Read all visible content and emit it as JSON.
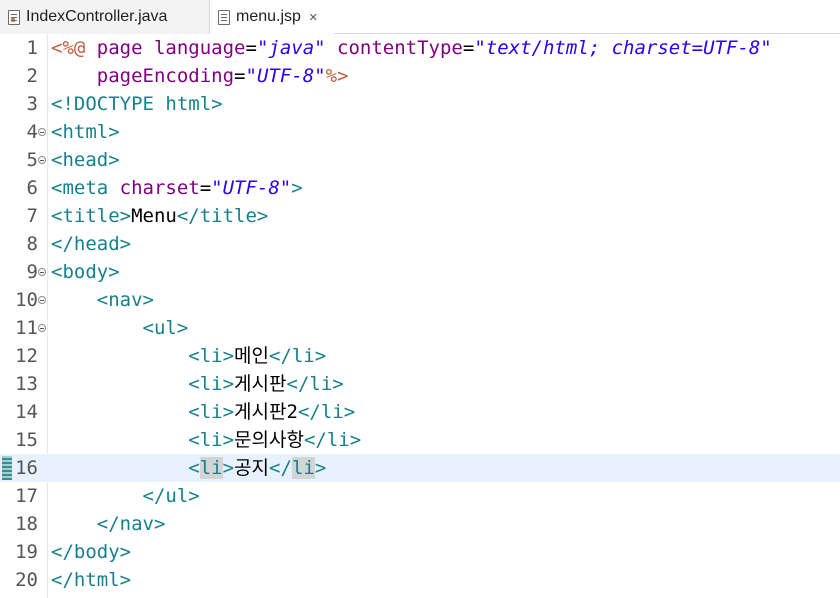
{
  "tabs": [
    {
      "label": "IndexController.java",
      "active": false,
      "icon": "java-file-icon"
    },
    {
      "label": "menu.jsp",
      "active": true,
      "icon": "jsp-file-icon",
      "close": "×"
    }
  ],
  "lines": [
    {
      "num": "1",
      "fold": false,
      "current": false,
      "segments": [
        {
          "t": "dir",
          "v": "<%@ "
        },
        {
          "t": "attr",
          "v": "page "
        },
        {
          "t": "attr",
          "v": "language"
        },
        {
          "t": "txt",
          "v": "="
        },
        {
          "t": "val",
          "v": "\"java\""
        },
        {
          "t": "txt",
          "v": " "
        },
        {
          "t": "attr",
          "v": "contentType"
        },
        {
          "t": "txt",
          "v": "="
        },
        {
          "t": "val",
          "v": "\"text/html; charset=UTF-8\""
        }
      ]
    },
    {
      "num": "2",
      "fold": false,
      "current": false,
      "segments": [
        {
          "t": "txt",
          "v": "    "
        },
        {
          "t": "attr",
          "v": "pageEncoding"
        },
        {
          "t": "txt",
          "v": "="
        },
        {
          "t": "val",
          "v": "\"UTF-8\""
        },
        {
          "t": "dir",
          "v": "%>"
        }
      ]
    },
    {
      "num": "3",
      "fold": false,
      "current": false,
      "segments": [
        {
          "t": "tag",
          "v": "<!DOCTYPE "
        },
        {
          "t": "kw",
          "v": "html"
        },
        {
          "t": "tag",
          "v": ">"
        }
      ]
    },
    {
      "num": "4",
      "fold": true,
      "current": false,
      "segments": [
        {
          "t": "tag",
          "v": "<html>"
        }
      ]
    },
    {
      "num": "5",
      "fold": true,
      "current": false,
      "segments": [
        {
          "t": "tag",
          "v": "<head>"
        }
      ]
    },
    {
      "num": "6",
      "fold": false,
      "current": false,
      "segments": [
        {
          "t": "tag",
          "v": "<meta "
        },
        {
          "t": "attr",
          "v": "charset"
        },
        {
          "t": "txt",
          "v": "="
        },
        {
          "t": "val",
          "v": "\"UTF-8\""
        },
        {
          "t": "tag",
          "v": ">"
        }
      ]
    },
    {
      "num": "7",
      "fold": false,
      "current": false,
      "segments": [
        {
          "t": "tag",
          "v": "<title>"
        },
        {
          "t": "txt",
          "v": "Menu"
        },
        {
          "t": "tag",
          "v": "</title>"
        }
      ]
    },
    {
      "num": "8",
      "fold": false,
      "current": false,
      "segments": [
        {
          "t": "tag",
          "v": "</head>"
        }
      ]
    },
    {
      "num": "9",
      "fold": true,
      "current": false,
      "segments": [
        {
          "t": "tag",
          "v": "<body>"
        }
      ]
    },
    {
      "num": "10",
      "fold": true,
      "current": false,
      "segments": [
        {
          "t": "txt",
          "v": "    "
        },
        {
          "t": "tag",
          "v": "<nav>"
        }
      ]
    },
    {
      "num": "11",
      "fold": true,
      "current": false,
      "segments": [
        {
          "t": "txt",
          "v": "        "
        },
        {
          "t": "tag",
          "v": "<ul>"
        }
      ]
    },
    {
      "num": "12",
      "fold": false,
      "current": false,
      "segments": [
        {
          "t": "txt",
          "v": "            "
        },
        {
          "t": "tag",
          "v": "<li>"
        },
        {
          "t": "txt",
          "v": "메인"
        },
        {
          "t": "tag",
          "v": "</li>"
        }
      ]
    },
    {
      "num": "13",
      "fold": false,
      "current": false,
      "segments": [
        {
          "t": "txt",
          "v": "            "
        },
        {
          "t": "tag",
          "v": "<li>"
        },
        {
          "t": "txt",
          "v": "게시판"
        },
        {
          "t": "tag",
          "v": "</li>"
        }
      ]
    },
    {
      "num": "14",
      "fold": false,
      "current": false,
      "segments": [
        {
          "t": "txt",
          "v": "            "
        },
        {
          "t": "tag",
          "v": "<li>"
        },
        {
          "t": "txt",
          "v": "게시판2"
        },
        {
          "t": "tag",
          "v": "</li>"
        }
      ]
    },
    {
      "num": "15",
      "fold": false,
      "current": false,
      "segments": [
        {
          "t": "txt",
          "v": "            "
        },
        {
          "t": "tag",
          "v": "<li>"
        },
        {
          "t": "txt",
          "v": "문의사항"
        },
        {
          "t": "tag",
          "v": "</li>"
        }
      ]
    },
    {
      "num": "16",
      "fold": false,
      "current": true,
      "segments": [
        {
          "t": "txt",
          "v": "            "
        },
        {
          "t": "tag",
          "v": "<"
        },
        {
          "t": "tag hl",
          "v": "li"
        },
        {
          "t": "tag",
          "v": ">"
        },
        {
          "t": "txt",
          "v": "공지"
        },
        {
          "t": "tag",
          "v": "</"
        },
        {
          "t": "tag hl",
          "v": "li"
        },
        {
          "t": "tag",
          "v": ">"
        }
      ]
    },
    {
      "num": "17",
      "fold": false,
      "current": false,
      "segments": [
        {
          "t": "txt",
          "v": "        "
        },
        {
          "t": "tag",
          "v": "</ul>"
        }
      ]
    },
    {
      "num": "18",
      "fold": false,
      "current": false,
      "segments": [
        {
          "t": "txt",
          "v": "    "
        },
        {
          "t": "tag",
          "v": "</nav>"
        }
      ]
    },
    {
      "num": "19",
      "fold": false,
      "current": false,
      "segments": [
        {
          "t": "tag",
          "v": "</body>"
        }
      ]
    },
    {
      "num": "20",
      "fold": false,
      "current": false,
      "segments": [
        {
          "t": "tag",
          "v": "</html>"
        }
      ]
    }
  ]
}
